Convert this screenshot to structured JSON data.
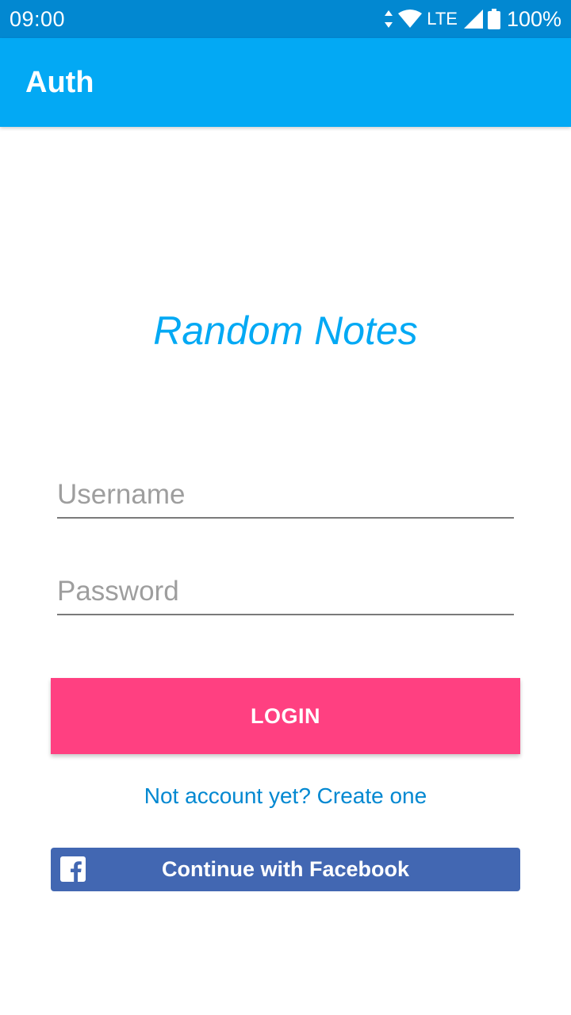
{
  "status_bar": {
    "time": "09:00",
    "network": "LTE",
    "battery": "100%",
    "icons": [
      "data-arrows-icon",
      "wifi-icon",
      "signal-icon",
      "battery-icon"
    ]
  },
  "app_bar": {
    "title": "Auth"
  },
  "main": {
    "brand_title": "Random Notes",
    "username_placeholder": "Username",
    "password_placeholder": "Password",
    "login_label": "LOGIN",
    "signup_link": "Not account yet? Create one",
    "facebook_label": "Continue with Facebook",
    "facebook_icon": "facebook-icon"
  },
  "colors": {
    "status_bar": "#0288d1",
    "app_bar": "#03a9f4",
    "brand": "#03a9f4",
    "login_button": "#ff4081",
    "link": "#0288d1",
    "facebook": "#4267b2"
  }
}
